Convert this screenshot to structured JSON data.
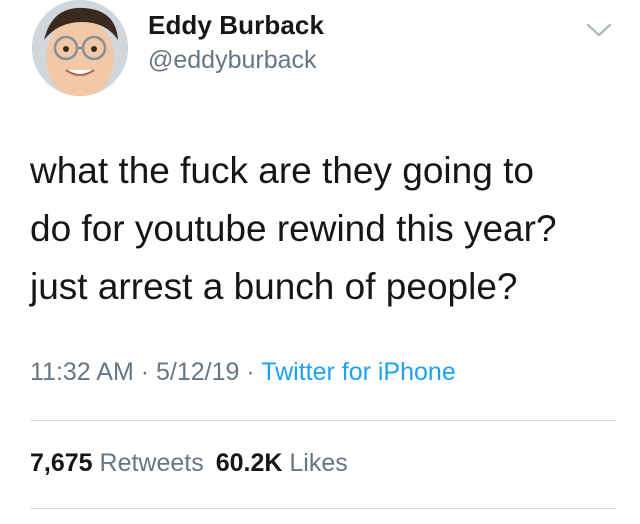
{
  "user": {
    "name": "Eddy Burback",
    "handle": "@eddyburback"
  },
  "icons": {
    "avatar": "profile-photo",
    "menu": "chevron-down-icon"
  },
  "tweet": {
    "lines": [
      "what the fuck are they going to",
      "do for youtube rewind this year?",
      "just arrest a bunch of people?"
    ]
  },
  "meta": {
    "time": "11:32 AM",
    "separator": " · ",
    "date": "5/12/19",
    "source": "Twitter for iPhone"
  },
  "stats": {
    "retweets_count": "7,675",
    "retweets_label": "Retweets",
    "likes_count": "60.2K",
    "likes_label": "Likes"
  },
  "colors": {
    "link": "#1da1f2",
    "secondary_text": "#657786",
    "primary_text": "#14171a",
    "divider": "#d9dee2"
  }
}
